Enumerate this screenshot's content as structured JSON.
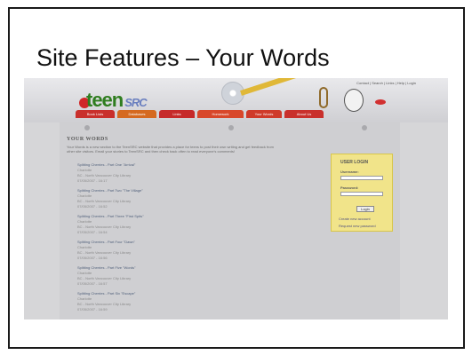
{
  "slide": {
    "title": "Site Features – Your Words"
  },
  "site": {
    "logo_text": "teen",
    "logo_suffix": "SRC",
    "top_links": "Contact | Search | Links | Help | Login",
    "nav": [
      {
        "label": "Book Lists",
        "color": "#c9302c"
      },
      {
        "label": "Databases",
        "color": "#d56a20"
      },
      {
        "label": "Links",
        "color": "#c62a2a"
      },
      {
        "label": "Homework",
        "color": "#d8482b"
      },
      {
        "label": "Your Words",
        "color": "#cf3a2a"
      },
      {
        "label": "About Us",
        "color": "#c9302c"
      }
    ]
  },
  "page": {
    "heading": "YOUR WORDS",
    "intro": "Your Words is a new section to the TeenSRC website that provides a place for teens to post their own writing and get feedback from other site visitors. Email your stories to TeenSRC and then check back often to read everyone's comments!",
    "entries": [
      {
        "title": "Splitting Cherries - Part One \"Arrival\"",
        "author": "Charlotte",
        "library": "BC - North Vancouver City Library",
        "date": "07/05/2007 - 16:17"
      },
      {
        "title": "Splitting Cherries - Part Two \"The Village\"",
        "author": "Charlotte",
        "library": "BC - North Vancouver City Library",
        "date": "07/05/2007 - 16:52"
      },
      {
        "title": "Splitting Cherries - Part Three \"First Spits\"",
        "author": "Charlotte",
        "library": "BC - North Vancouver City Library",
        "date": "07/05/2007 - 16:54"
      },
      {
        "title": "Splitting Cherries - Part Four \"Dawn\"",
        "author": "Charlotte",
        "library": "BC - North Vancouver City Library",
        "date": "07/05/2007 - 16:56"
      },
      {
        "title": "Splitting Cherries - Part Five \"Words\"",
        "author": "Charlotte",
        "library": "BC - North Vancouver City Library",
        "date": "07/05/2007 - 16:57"
      },
      {
        "title": "Splitting Cherries - Part Six \"Escape\"",
        "author": "Charlotte",
        "library": "BC - North Vancouver City Library",
        "date": "07/05/2007 - 16:59"
      }
    ]
  },
  "login": {
    "title": "USER LOGIN",
    "username_label": "Username:",
    "password_label": "Password:",
    "button_label": "Login",
    "create_link": "Create new account",
    "forgot_link": "Request new password"
  }
}
